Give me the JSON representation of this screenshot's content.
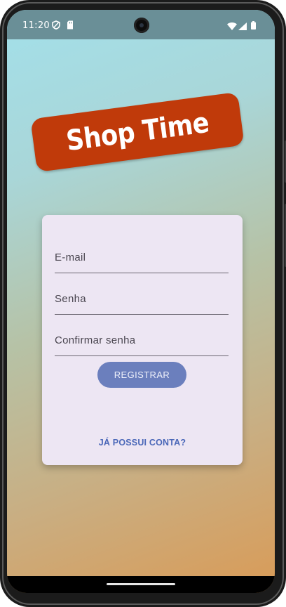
{
  "status_bar": {
    "time": "11:20",
    "left_icons": [
      "vpn-shield-icon",
      "sd-card-icon"
    ],
    "right_icons": [
      "wifi-icon",
      "cellular-signal-icon",
      "battery-icon"
    ]
  },
  "logo": {
    "text": "Shop Time",
    "background": "#c03a0a",
    "text_color": "#ffffff"
  },
  "form": {
    "email": {
      "placeholder": "E-mail",
      "value": ""
    },
    "password": {
      "placeholder": "Senha",
      "value": ""
    },
    "confirm_password": {
      "placeholder": "Confirmar senha",
      "value": ""
    },
    "register_label": "REGISTRAR",
    "login_link": "JÁ POSSUI CONTA?"
  },
  "colors": {
    "gradient_top": "#a3e0ea",
    "gradient_bottom": "#d99b57",
    "card_background": "#ede6f3",
    "button": "#6b7fbd",
    "link": "#4a67b8"
  }
}
